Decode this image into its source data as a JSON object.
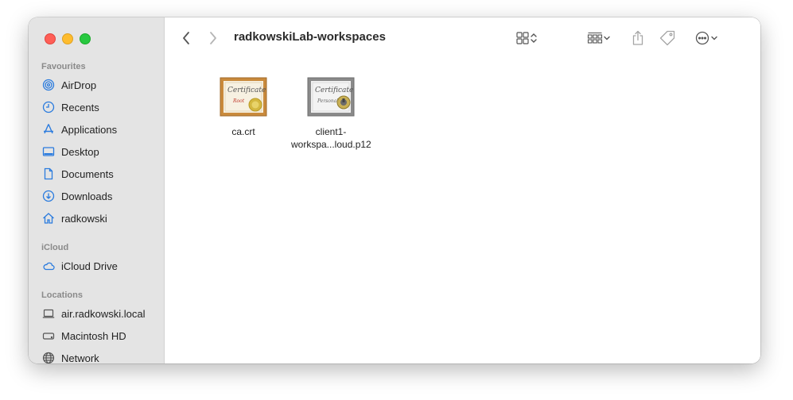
{
  "window": {
    "title": "radkowskiLab-workspaces"
  },
  "sidebar": {
    "favourites_label": "Favourites",
    "favourites": [
      {
        "label": "AirDrop",
        "icon": "airdrop-icon"
      },
      {
        "label": "Recents",
        "icon": "clock-icon"
      },
      {
        "label": "Applications",
        "icon": "applications-icon"
      },
      {
        "label": "Desktop",
        "icon": "desktop-icon"
      },
      {
        "label": "Documents",
        "icon": "document-icon"
      },
      {
        "label": "Downloads",
        "icon": "download-icon"
      },
      {
        "label": "radkowski",
        "icon": "home-icon"
      }
    ],
    "icloud_label": "iCloud",
    "icloud": [
      {
        "label": "iCloud Drive",
        "icon": "cloud-icon"
      }
    ],
    "locations_label": "Locations",
    "locations": [
      {
        "label": "air.radkowski.local",
        "icon": "laptop-icon"
      },
      {
        "label": "Macintosh HD",
        "icon": "disk-icon"
      },
      {
        "label": "Network",
        "icon": "globe-icon"
      }
    ]
  },
  "files": [
    {
      "name": "ca.crt",
      "thumb_word": "Certificate",
      "thumb_sub": "Root"
    },
    {
      "name": "client1-",
      "name2": "workspa...loud.p12",
      "thumb_word": "Certificate",
      "thumb_sub": "Personal"
    }
  ],
  "colors": {
    "accent": "#2a7bde",
    "sidebar_bg": "#e4e4e4"
  }
}
